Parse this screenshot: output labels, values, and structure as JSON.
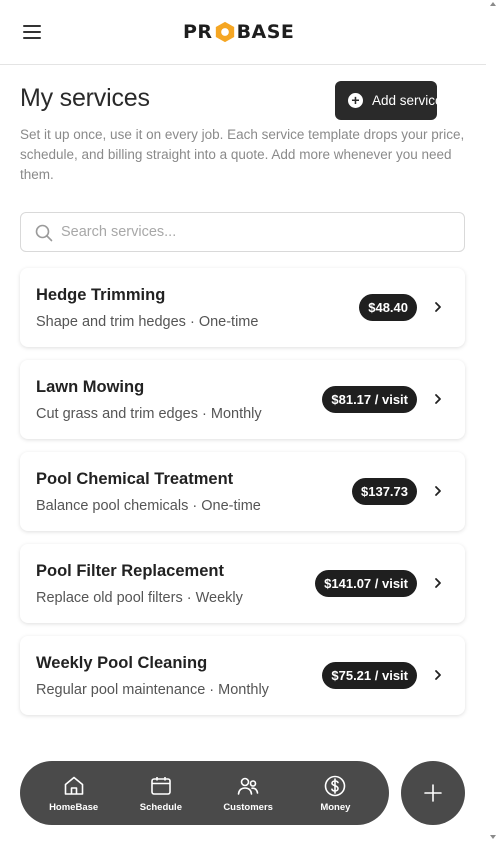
{
  "header": {
    "menu_icon": "hamburger-menu-icon",
    "logo_left": "PR",
    "logo_right": "BASE",
    "logo_mark": "hexagon-icon",
    "brand_color": "#f5a623"
  },
  "page": {
    "title": "My services",
    "add_button_label": "Add service",
    "description": "Set it up once, use it on every job. Each service template drops your price, schedule, and billing straight into a quote. Add more whenever you need them."
  },
  "search": {
    "placeholder": "Search services...",
    "value": ""
  },
  "services": [
    {
      "name": "Hedge Trimming",
      "meta": "Shape and trim hedges · One-time",
      "price": "$48.40"
    },
    {
      "name": "Lawn Mowing",
      "meta": "Cut grass and trim edges · Monthly",
      "price": "$81.17 / visit"
    },
    {
      "name": "Pool Chemical Treatment",
      "meta": "Balance pool chemicals · One-time",
      "price": "$137.73"
    },
    {
      "name": "Pool Filter Replacement",
      "meta": "Replace old pool filters · Weekly",
      "price": "$141.07 / visit"
    },
    {
      "name": "Weekly Pool Cleaning",
      "meta": "Regular pool maintenance · Monthly",
      "price": "$75.21 / visit"
    }
  ],
  "bottom_nav": [
    {
      "label": "HomeBase",
      "icon": "home-icon"
    },
    {
      "label": "Schedule",
      "icon": "calendar-icon"
    },
    {
      "label": "Customers",
      "icon": "users-icon"
    },
    {
      "label": "Money",
      "icon": "dollar-icon"
    }
  ],
  "fab_icon": "plus-icon"
}
